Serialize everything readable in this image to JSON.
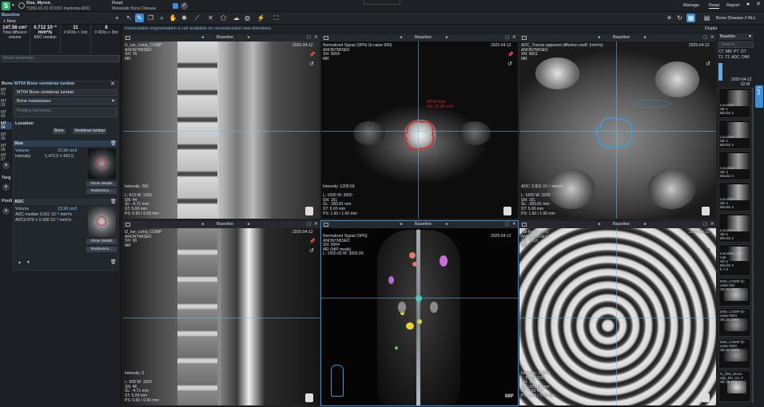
{
  "topbar": {
    "patient_name": "Doe, Myron_",
    "patient_meta": "*1950-01-01 ID:DST-myeloma-0001",
    "study_tab": "Read",
    "study_sub": "Metastatic Bone Disease",
    "menu": {
      "manage": "Manage",
      "read": "Read",
      "report": "Report"
    },
    "baseline_label": "Baseline",
    "new_label": "+ New"
  },
  "toolbar": {
    "notice": "Interpolation segmentation is not available on reconstructed view directions.",
    "display_measurements": "Display measurements",
    "hanging": "Bone Disease // ALL"
  },
  "stats": [
    {
      "value": "147.58 cm³",
      "label": "Total diffusion volume"
    },
    {
      "value": "0.712 10⁻³ mm²/s",
      "label": "ADC median"
    },
    {
      "value": "11",
      "label": "# ROIs > 1ml"
    },
    {
      "value": "8",
      "label": "# ROIs > 3ml"
    }
  ],
  "read_summary": "Read summary...",
  "finding": {
    "section_label": "Bone",
    "title": "MT04 Bone vertebrae lumbar",
    "name_value": "MT04  Bone vertebrae lumbar",
    "type_value": "Bone metastases",
    "comment_placeholder": "Finding comment...",
    "location_label": "Location",
    "loc_chip1": "Bone",
    "loc_chip2": "Vertebrae lumbar",
    "size_label": "Size",
    "volume_label": "Volume",
    "volume_value": "23.98 cm3",
    "intensity_label": "Intensity",
    "intensity_value": "1,472.5 ± 442.5",
    "show_details": "Show details",
    "radiomics": "Radiomics...",
    "adc_label": "ADC",
    "adc_volume_label": "Volume",
    "adc_volume_value": "23.98 cm3",
    "adc_median": "ADC median 0.911 10⁻³ mm²/s",
    "adc_range": "ADC0.876 ± 0.366 10⁻³ mm²/s",
    "show_details2": "Show details",
    "radiomics2": "Radiomics..."
  },
  "side_tags": [
    "MT 01",
    "MT 02",
    "MT 03",
    "MT 04",
    "MT 05",
    "MT 06",
    "MT 07"
  ],
  "side_sections": {
    "targ": "Targ",
    "find": "Findi"
  },
  "viewports": [
    {
      "label": "Baseline",
      "tl": "t1_tse_comp_COMP\nANONYMISED\nSN: 70\nMR",
      "tr": "2025-04-12",
      "bl": "Intensity: 280\n\nL: 613 W: 1260\nSN: 44\nSL: -4.71 mm\nST: 5.00 mm\nPS: 0.60 / 0.60 mm"
    },
    {
      "label": "Baseline",
      "tl": "Normalized Signal (SPN) (b-value 900)\nANONYMISED\nSN: 9004\nMR",
      "tr": "2025-04-12",
      "bl": "Intensity: 1209.59\n\nL: 1500 W: 3000\nSN: 161\nSL: -383.81 mm\nST: 5.00 mm\nPS: 1.60 / 1.60 mm",
      "roi": "MT04 Size\nVol: 23.98 cm3"
    },
    {
      "label": "Baseline",
      "tl": "ADC_Tracew apparent diffusion coeff. (mm²/s)\nANONYMISED\nSN: 9001\nMR",
      "tr": "2025-04-12",
      "bl": "ADC: 0.831 10⁻³ mm²/s\n\nL: 1600 W: 3200\nSN: 161\nSL: -383.81 mm\nST: 5.00 mm\nPS: 1.60 / 1.60 mm"
    },
    {
      "label": "Baseline",
      "tl": "t2_tse_comp_COMP\nANONYMISED\nSN: 60\nMR",
      "tr": "2025-04-12",
      "bl": "Intensity: 0\n\nL: 909 W: 1820\nSN: 46\nSL: -4.71 mm\nST: 5.00 mm\nPS: 0.60 / 0.60 mm"
    },
    {
      "label": "Baseline",
      "tl": "Normalized Signal (SPN)\nANONYMISED\nSN: 9004\nMR (MIP mode)\nL: 1500.00 W: 3000.00",
      "tr": "2025-04-12",
      "br": "MIP"
    },
    {
      "label": "Baseline",
      "tl": "Fat-fraction (%)\nANONYMISED\nSN: 9003\nMR",
      "tr": "2025-04-12",
      "bl": "Intensity: 1.49 %\nL: 50 W: 100\nSN: 161\nSL: -383.81 mm\nST: 5.00 mm\nPS: 1.60 / 1.60 mm"
    }
  ],
  "right": {
    "baseline": "Baseline",
    "search_placeholder": "Search...",
    "chips": [
      "CT",
      "MR",
      "PT",
      "OT",
      "T1",
      "T2",
      "ADC",
      "DWI"
    ],
    "date": "2025-04-12",
    "age": "62 M",
    "thumbs": [
      "Localiser\nSE 1\nBlocks 2",
      "Localiser\nSE 2\nBlocks 2",
      "Localiser\nSE 3\nBlocks 2",
      "Localiser\nSE 4\nBlocks 2",
      "Localiser\nSE 5\nBlocks 2",
      "Localiser_CO\nmpI\nSE 6\nBlocks 2\nb 7.3",
      "DWI_COMP (b-\nvalue 50)\nSE 21 (280)",
      "DWI_COMP (b-\nvalue 900)\nSE 21 (280)",
      "DWI_COMP (b-\nvalue 900)\nSE 21 (280)",
      "t1_fl2d_Dixon\nopp_BH_tra_F\nSE 25 (44)"
    ],
    "side_tab": "Lync"
  }
}
